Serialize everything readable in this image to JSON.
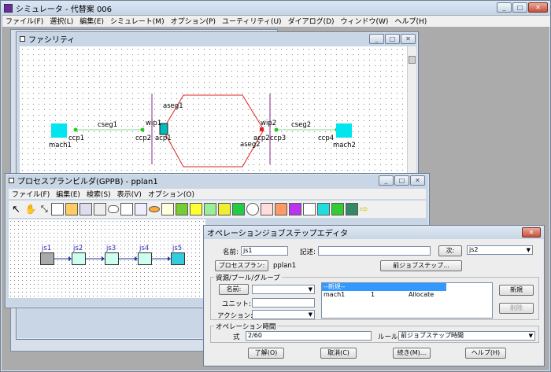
{
  "main_window": {
    "title": "シミュレータ - 代替案 006",
    "menu": [
      "ファイル(F)",
      "選択(L)",
      "編集(E)",
      "シミュレート(M)",
      "オプション(P)",
      "ユーティリティ(U)",
      "ダイアログ(D)",
      "ウィンドウ(W)",
      "ヘルプ(H)"
    ]
  },
  "facility": {
    "title": "ファシリティ",
    "labels": {
      "cseg1": "cseg1",
      "wip1": "wip1",
      "aseg1": "aseg1",
      "ccp1": "ccp1",
      "ccp2": "ccp2",
      "acp1": "acp1",
      "mach1": "mach1",
      "wip2": "wip2",
      "cseg2": "cseg2",
      "aseg2": "aseg2",
      "acp2": "acp2",
      "ccp3": "ccp3",
      "ccp4": "ccp4",
      "mach2": "mach2"
    }
  },
  "gppb": {
    "title": "プロセスプランビルダ(GPPB) - pplan1",
    "menu": [
      "ファイル(F)",
      "編集(E)",
      "検索(S)",
      "表示(V)",
      "オプション(O)"
    ],
    "jobs": [
      "js1",
      "js2",
      "js3",
      "js4",
      "js5"
    ]
  },
  "editor": {
    "title": "オペレーションジョブステップエディタ",
    "name_label": "名前:",
    "name_value": "js1",
    "desc_label": "記述:",
    "desc_value": "",
    "next_button": "次:",
    "next_value": "js2",
    "process_plan_button": "プロセスプラン:",
    "process_plan_value": "pplan1",
    "prev_button": "前ジョブステップ...",
    "resource_group": "資源/プール/グループ",
    "res_name_button": "名前:",
    "res_name_value": "",
    "unit_label": "ユニット:",
    "unit_value": "",
    "action_label": "アクション:",
    "action_value": "",
    "list_selected": "--新規--",
    "list_row": [
      "mach1",
      "1",
      "Allocate"
    ],
    "new_button": "新規",
    "delete_button": "削除",
    "op_time_group": "オペレーション時間",
    "expr_label": "式",
    "expr_value": "2/60",
    "rule_label": "ルール:",
    "rule_value": "前ジョブステップ時間",
    "ok_button": "了解(O)",
    "cancel_button": "取消(C)",
    "continue_button": "続き(M)...",
    "help_button": "ヘルプ(H)"
  }
}
